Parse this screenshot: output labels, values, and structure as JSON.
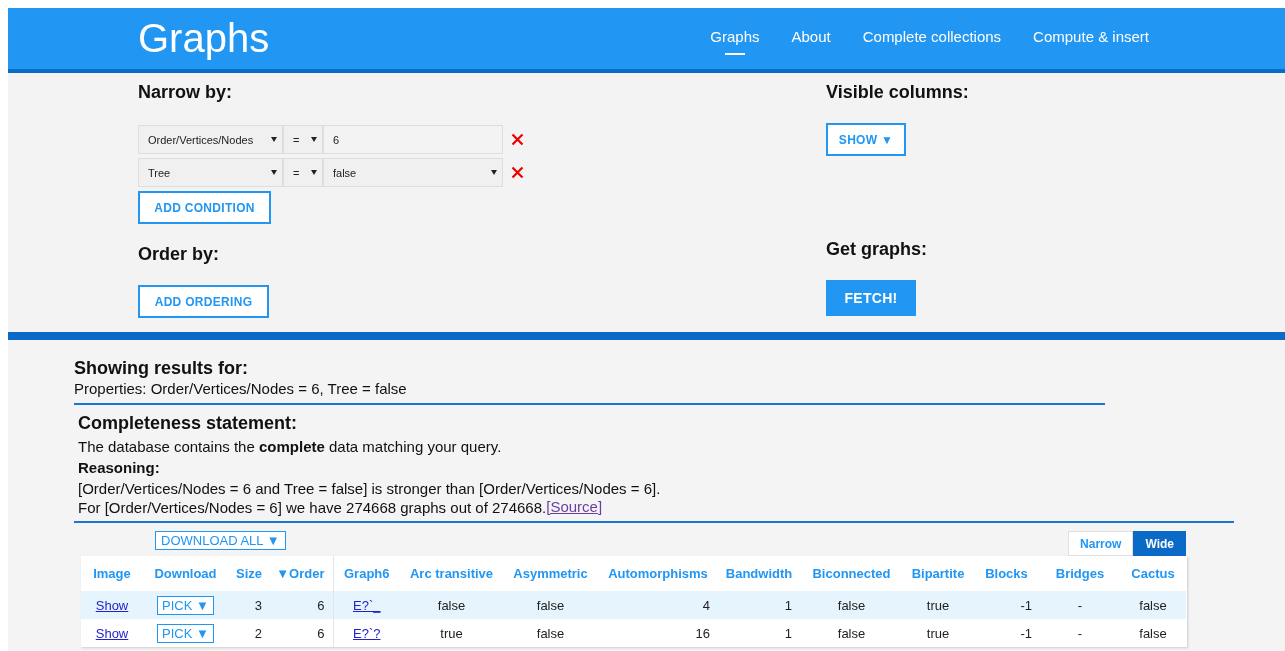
{
  "header": {
    "title": "Graphs",
    "nav": [
      {
        "label": "Graphs",
        "selected": true
      },
      {
        "label": "About",
        "selected": false
      },
      {
        "label": "Complete collections",
        "selected": false
      },
      {
        "label": "Compute & insert",
        "selected": false
      }
    ]
  },
  "filter": {
    "narrow_heading": "Narrow by:",
    "conditions": [
      {
        "property": "Order/Vertices/Nodes",
        "operator": "=",
        "value": "6",
        "kind": "text"
      },
      {
        "property": "Tree",
        "operator": "=",
        "value": "false",
        "kind": "select"
      }
    ],
    "add_condition": "ADD CONDITION",
    "order_heading": "Order by:",
    "add_ordering": "ADD ORDERING",
    "visible_heading": "Visible columns:",
    "show_button": "SHOW ▼",
    "get_heading": "Get graphs:",
    "fetch_button": "FETCH!"
  },
  "results": {
    "heading": "Showing results for:",
    "properties": "Properties: Order/Vertices/Nodes = 6, Tree = false",
    "completeness": {
      "heading": "Completeness statement:",
      "statement": "The database contains the **complete** data matching your query.",
      "reasoning_heading": "Reasoning:",
      "reasoning_line": "[Order/Vertices/Nodes = 6 and Tree = false] is stronger than [Order/Vertices/Nodes = 6].",
      "count_line": "For [Order/Vertices/Nodes = 6] we have 274668 graphs out of 274668.",
      "source_link": "[Source]"
    }
  },
  "table": {
    "download_all": "DOWNLOAD ALL ▼",
    "sort_mark": "▼",
    "view_toggle": [
      {
        "label": "Narrow",
        "selected": false
      },
      {
        "label": "Wide",
        "selected": true
      }
    ],
    "columns": [
      {
        "label": "Image",
        "kind": "link",
        "sorted": false
      },
      {
        "label": "Download",
        "kind": "pick",
        "sorted": false
      },
      {
        "label": "Size",
        "kind": "number",
        "sorted": false
      },
      {
        "label": "Order",
        "kind": "number",
        "sorted": true
      },
      {
        "label": "Graph6",
        "kind": "link",
        "sorted": false
      },
      {
        "label": "Arc transitive",
        "kind": "text",
        "sorted": false
      },
      {
        "label": "Asymmetric",
        "kind": "text",
        "sorted": false
      },
      {
        "label": "Automorphisms",
        "kind": "number",
        "sorted": false
      },
      {
        "label": "Bandwidth",
        "kind": "number",
        "sorted": false
      },
      {
        "label": "Biconnected",
        "kind": "text",
        "sorted": false
      },
      {
        "label": "Bipartite",
        "kind": "text",
        "sorted": false
      },
      {
        "label": "Blocks",
        "kind": "number",
        "sorted": false
      },
      {
        "label": "Bridges",
        "kind": "text",
        "sorted": false
      },
      {
        "label": "Cactus",
        "kind": "text",
        "sorted": false
      }
    ],
    "rows": [
      [
        "Show",
        "PICK ▼",
        "3",
        "6",
        "E?`_",
        "false",
        "false",
        "4",
        "1",
        "false",
        "true",
        "-1",
        "-",
        "false"
      ],
      [
        "Show",
        "PICK ▼",
        "2",
        "6",
        "E?`?",
        "true",
        "false",
        "16",
        "1",
        "false",
        "true",
        "-1",
        "-",
        "false"
      ]
    ]
  }
}
